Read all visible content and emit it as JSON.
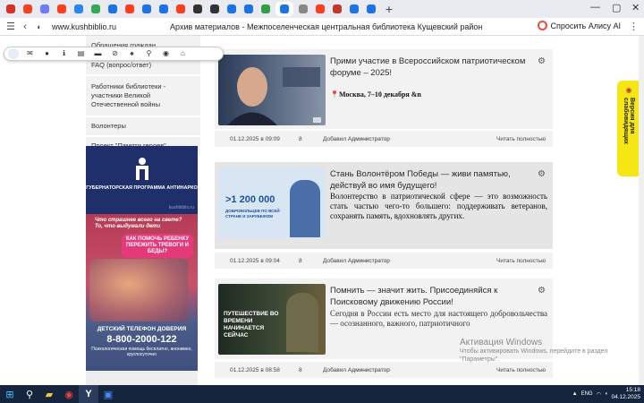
{
  "browser": {
    "tabs": [
      {
        "icon": "alert-icon",
        "color": "#d93025"
      },
      {
        "icon": "yandex-icon",
        "color": "#fc3f1d"
      },
      {
        "icon": "mail-icon",
        "color": "#6b7cff"
      },
      {
        "icon": "yandex-icon",
        "color": "#fc3f1d"
      },
      {
        "icon": "vk-icon",
        "color": "#2787f5"
      },
      {
        "icon": "site-icon",
        "color": "#34a853"
      },
      {
        "icon": "globe-icon",
        "color": "#1a73e8"
      },
      {
        "icon": "yandex-icon",
        "color": "#fc3f1d"
      },
      {
        "icon": "doc-icon",
        "color": "#1a73e8"
      },
      {
        "icon": "globe-icon",
        "color": "#1a73e8"
      },
      {
        "icon": "yandex-icon",
        "color": "#fc3f1d"
      },
      {
        "icon": "globe-icon",
        "color": "#333"
      },
      {
        "icon": "globe-icon",
        "color": "#333"
      },
      {
        "icon": "globe-icon",
        "color": "#1a73e8"
      },
      {
        "icon": "globe-icon",
        "color": "#1a73e8"
      },
      {
        "icon": "site-icon",
        "color": "#2f9e44"
      },
      {
        "icon": "globe-icon",
        "color": "#1a73e8"
      },
      {
        "icon": "globe-icon",
        "color": "#888"
      },
      {
        "icon": "yandex-icon",
        "color": "#fc3f1d"
      },
      {
        "icon": "gov-icon",
        "color": "#c0392b"
      },
      {
        "icon": "globe-icon",
        "color": "#1a73e8"
      },
      {
        "icon": "globe-icon",
        "color": "#1a73e8"
      }
    ],
    "url": "www.kushbiblio.ru",
    "page_title": "Архив материалов - Межпоселенческая центральная библиотека Кущевский район",
    "alice_label": "Спросить Алису AI"
  },
  "sidebar": {
    "items": [
      "Обращения граждан",
      "FAQ (вопрос/ответ)",
      "Работники библиотеки - участники Великой Отечественной войны",
      "Волонтеры",
      "Проект \"Памяти героев\""
    ]
  },
  "banner": {
    "top_text": "ГУБЕРНАТОРСКАЯ ПРОГРАММА АНТИНАРКО",
    "watermark": "kushbiblio.ru",
    "question": "Что страшнее всего на свете? То, что выдумали дети",
    "pill": "КАК ПОМОЧЬ РЕБЕНКУ ПЕРЕЖИТЬ ТРЕВОГИ И БЕДЫ?",
    "phone_label": "ДЕТСКИЙ ТЕЛЕФОН ДОВЕРИЯ",
    "phone": "8-800-2000-122",
    "phone_note": "Психологическая помощь бесплатно, анонимно, круглосуточно"
  },
  "posts": [
    {
      "title": "Прими участие в Всероссийском патриотическом форуме – 2025!",
      "body": "📍Москва, 7–10 декабря &n",
      "date": "01.12.2025 в 09:09",
      "views": "8",
      "added_label": "Добавил",
      "author": "Администратор",
      "read_more": "Читать полностью"
    },
    {
      "title": "Стань Волонтёром Победы — живи памятью, действуй во имя будущего!",
      "body": "Волонтерство в патриотической сфере — это возможность стать частью чего-то большего: поддерживать ветеранов, сохранять память, вдохновлять других.",
      "image_text": ">1 200 000",
      "image_sub": "ДОБРОВОЛЬЦЕВ ПО ВСЕЙ СТРАНЕ И ЗАРУБЕЖОМ",
      "date": "01.12.2025 в 09:04",
      "views": "8",
      "added_label": "Добавил",
      "author": "Администратор",
      "read_more": "Читать полностью"
    },
    {
      "title": "Помнить — значит жить. Присоединяйся к Поисковому движению России!",
      "body": "Сегодня в России есть место для настоящего добровольчества — осознанного, важного, патриотичного",
      "image_text": "ПУТЕШЕСТВИЕ ВО ВРЕМЕНИ НАЧИНАЕТСЯ СЕЙЧАС",
      "date": "01.12.2025 в 08:58",
      "views": "8",
      "added_label": "Добавил",
      "author": "Администратор",
      "read_more": "Читать полностью"
    }
  ],
  "side_tab": "Версия для слабовидящих",
  "windows_activation": {
    "title": "Активация Windows",
    "text": "Чтобы активировать Windows, перейдите в раздел \"Параметры\"."
  },
  "taskbar": {
    "lang": "ENG",
    "time": "15:18",
    "date": "04.12.2025"
  }
}
